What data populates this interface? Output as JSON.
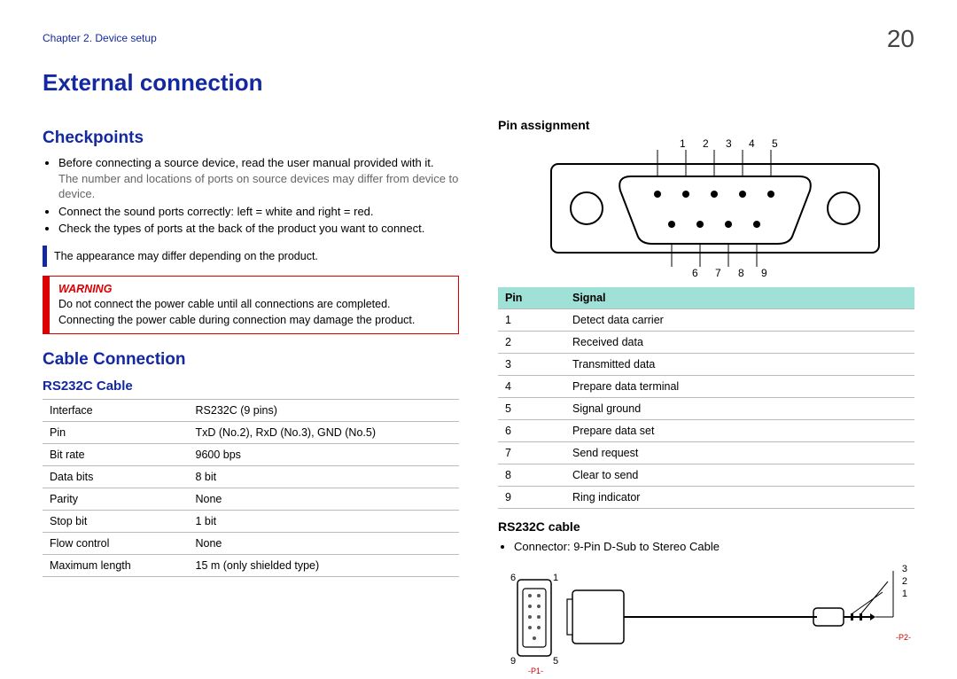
{
  "breadcrumb": "Chapter 2.  Device setup",
  "pageNumber": "20",
  "title": "External connection",
  "checkpoints": {
    "heading": "Checkpoints",
    "items": [
      {
        "text": "Before connecting a source device, read the user manual provided with it.",
        "sub": "The number and locations of ports on source devices may differ from device to device."
      },
      {
        "text": "Connect the sound ports correctly: left = white and right = red."
      },
      {
        "text": "Check the types of ports at the back of the product you want to connect."
      }
    ],
    "note": "The appearance may differ depending on the product.",
    "warningLabel": "WARNING",
    "warning1": "Do not connect the power cable until all connections are completed.",
    "warning2": "Connecting the power cable during connection may damage the product."
  },
  "cableConnection": {
    "heading": "Cable Connection",
    "sub1": "RS232C Cable",
    "specs": [
      {
        "k": "Interface",
        "v": "RS232C (9 pins)"
      },
      {
        "k": "Pin",
        "v": "TxD (No.2), RxD (No.3), GND (No.5)"
      },
      {
        "k": "Bit rate",
        "v": "9600 bps"
      },
      {
        "k": "Data bits",
        "v": "8 bit"
      },
      {
        "k": "Parity",
        "v": "None"
      },
      {
        "k": "Stop bit",
        "v": "1 bit"
      },
      {
        "k": "Flow control",
        "v": "None"
      },
      {
        "k": "Maximum length",
        "v": "15 m (only shielded type)"
      }
    ]
  },
  "pinAssignment": {
    "heading": "Pin assignment",
    "topRow": "1  2  3  4  5",
    "bottomRow": "6  7  8  9",
    "tableHead": {
      "pin": "Pin",
      "signal": "Signal"
    },
    "rows": [
      {
        "pin": "1",
        "signal": "Detect data carrier"
      },
      {
        "pin": "2",
        "signal": "Received data"
      },
      {
        "pin": "3",
        "signal": "Transmitted data"
      },
      {
        "pin": "4",
        "signal": "Prepare data terminal"
      },
      {
        "pin": "5",
        "signal": "Signal ground"
      },
      {
        "pin": "6",
        "signal": "Prepare data set"
      },
      {
        "pin": "7",
        "signal": "Send request"
      },
      {
        "pin": "8",
        "signal": "Clear to send"
      },
      {
        "pin": "9",
        "signal": "Ring indicator"
      }
    ]
  },
  "cableFigure": {
    "heading": "RS232C cable",
    "bullet": "Connector: 9-Pin D-Sub to Stereo Cable",
    "leftLabels": {
      "tl": "6",
      "tr": "1",
      "bl": "9",
      "br": "5"
    },
    "rightLabels": {
      "a": "3",
      "b": "2",
      "c": "1"
    },
    "p1": "-P1-",
    "p2": "-P2-"
  }
}
